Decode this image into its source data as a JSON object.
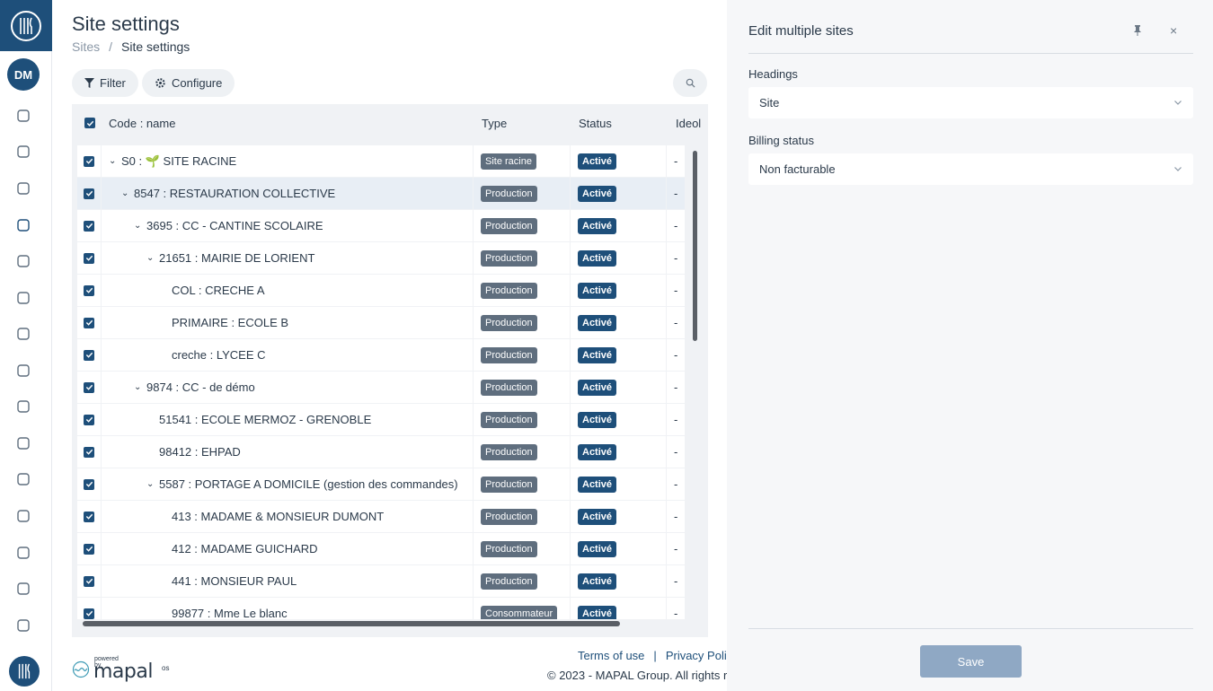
{
  "page": {
    "title": "Site settings",
    "breadcrumb": {
      "parent": "Sites",
      "separator": "/",
      "current": "Site settings"
    }
  },
  "toolbar": {
    "filter_label": "Filter",
    "configure_label": "Configure"
  },
  "grid": {
    "columns": {
      "name": "Code : name",
      "type": "Type",
      "status": "Status",
      "ideo": "Ideol"
    },
    "rows": [
      {
        "indent": 0,
        "chevron": true,
        "name": "S0 : 🌱 SITE RACINE",
        "type": "Site racine",
        "status": "Activé",
        "ideo": "-",
        "selected": false
      },
      {
        "indent": 1,
        "chevron": true,
        "name": "8547 : RESTAURATION COLLECTIVE",
        "type": "Production",
        "status": "Activé",
        "ideo": "-",
        "selected": true
      },
      {
        "indent": 2,
        "chevron": true,
        "name": "3695 : CC - CANTINE SCOLAIRE",
        "type": "Production",
        "status": "Activé",
        "ideo": "-",
        "selected": false
      },
      {
        "indent": 3,
        "chevron": true,
        "name": "21651 : MAIRIE DE LORIENT",
        "type": "Production",
        "status": "Activé",
        "ideo": "-",
        "selected": false
      },
      {
        "indent": 4,
        "chevron": false,
        "name": "COL : CRECHE A",
        "type": "Production",
        "status": "Activé",
        "ideo": "-",
        "selected": false
      },
      {
        "indent": 4,
        "chevron": false,
        "name": "PRIMAIRE : ECOLE B",
        "type": "Production",
        "status": "Activé",
        "ideo": "-",
        "selected": false
      },
      {
        "indent": 4,
        "chevron": false,
        "name": "creche : LYCEE C",
        "type": "Production",
        "status": "Activé",
        "ideo": "-",
        "selected": false
      },
      {
        "indent": 2,
        "chevron": true,
        "name": "9874 : CC - de démo",
        "type": "Production",
        "status": "Activé",
        "ideo": "-",
        "selected": false
      },
      {
        "indent": 3,
        "chevron": false,
        "name": "51541 : ECOLE MERMOZ - GRENOBLE",
        "type": "Production",
        "status": "Activé",
        "ideo": "-",
        "selected": false
      },
      {
        "indent": 3,
        "chevron": false,
        "name": "98412 : EHPAD",
        "type": "Production",
        "status": "Activé",
        "ideo": "-",
        "selected": false
      },
      {
        "indent": 3,
        "chevron": true,
        "name": "5587 : PORTAGE A DOMICILE (gestion des commandes)",
        "type": "Production",
        "status": "Activé",
        "ideo": "-",
        "selected": false
      },
      {
        "indent": 4,
        "chevron": false,
        "name": "413 : MADAME & MONSIEUR DUMONT",
        "type": "Production",
        "status": "Activé",
        "ideo": "-",
        "selected": false
      },
      {
        "indent": 4,
        "chevron": false,
        "name": "412 : MADAME GUICHARD",
        "type": "Production",
        "status": "Activé",
        "ideo": "-",
        "selected": false
      },
      {
        "indent": 4,
        "chevron": false,
        "name": "441 : MONSIEUR PAUL",
        "type": "Production",
        "status": "Activé",
        "ideo": "-",
        "selected": false
      },
      {
        "indent": 4,
        "chevron": false,
        "name": "99877 : Mme Le blanc",
        "type": "Consommateur",
        "status": "Activé",
        "ideo": "-",
        "selected": false
      }
    ]
  },
  "footer": {
    "terms": "Terms of use",
    "divider": "|",
    "privacy": "Privacy Poli",
    "copyright": "© 2023 - MAPAL Group. All rights r",
    "powered_by": "powered by",
    "brand": "mapal",
    "brand_suffix": "os"
  },
  "sidebar": {
    "avatar_initials": "DM",
    "icons": [
      "home-icon",
      "edit-list-icon",
      "clipboard-icon",
      "store-icon",
      "building-icon",
      "handshake-icon",
      "handshake-icon",
      "bag-icon",
      "chef-hat-icon",
      "settings-icon",
      "basket-icon",
      "heart-document-icon",
      "document-list-icon",
      "bell-icon",
      "cart-icon"
    ]
  },
  "panel": {
    "title": "Edit multiple sites",
    "close": "×",
    "headings_label": "Headings",
    "headings_value": "Site",
    "billing_label": "Billing status",
    "billing_value": "Non facturable",
    "save_label": "Save"
  },
  "colors": {
    "brand": "#1e4f7a",
    "save_disabled": "#8fa8c4",
    "type_badge": "#5f6e7e"
  }
}
